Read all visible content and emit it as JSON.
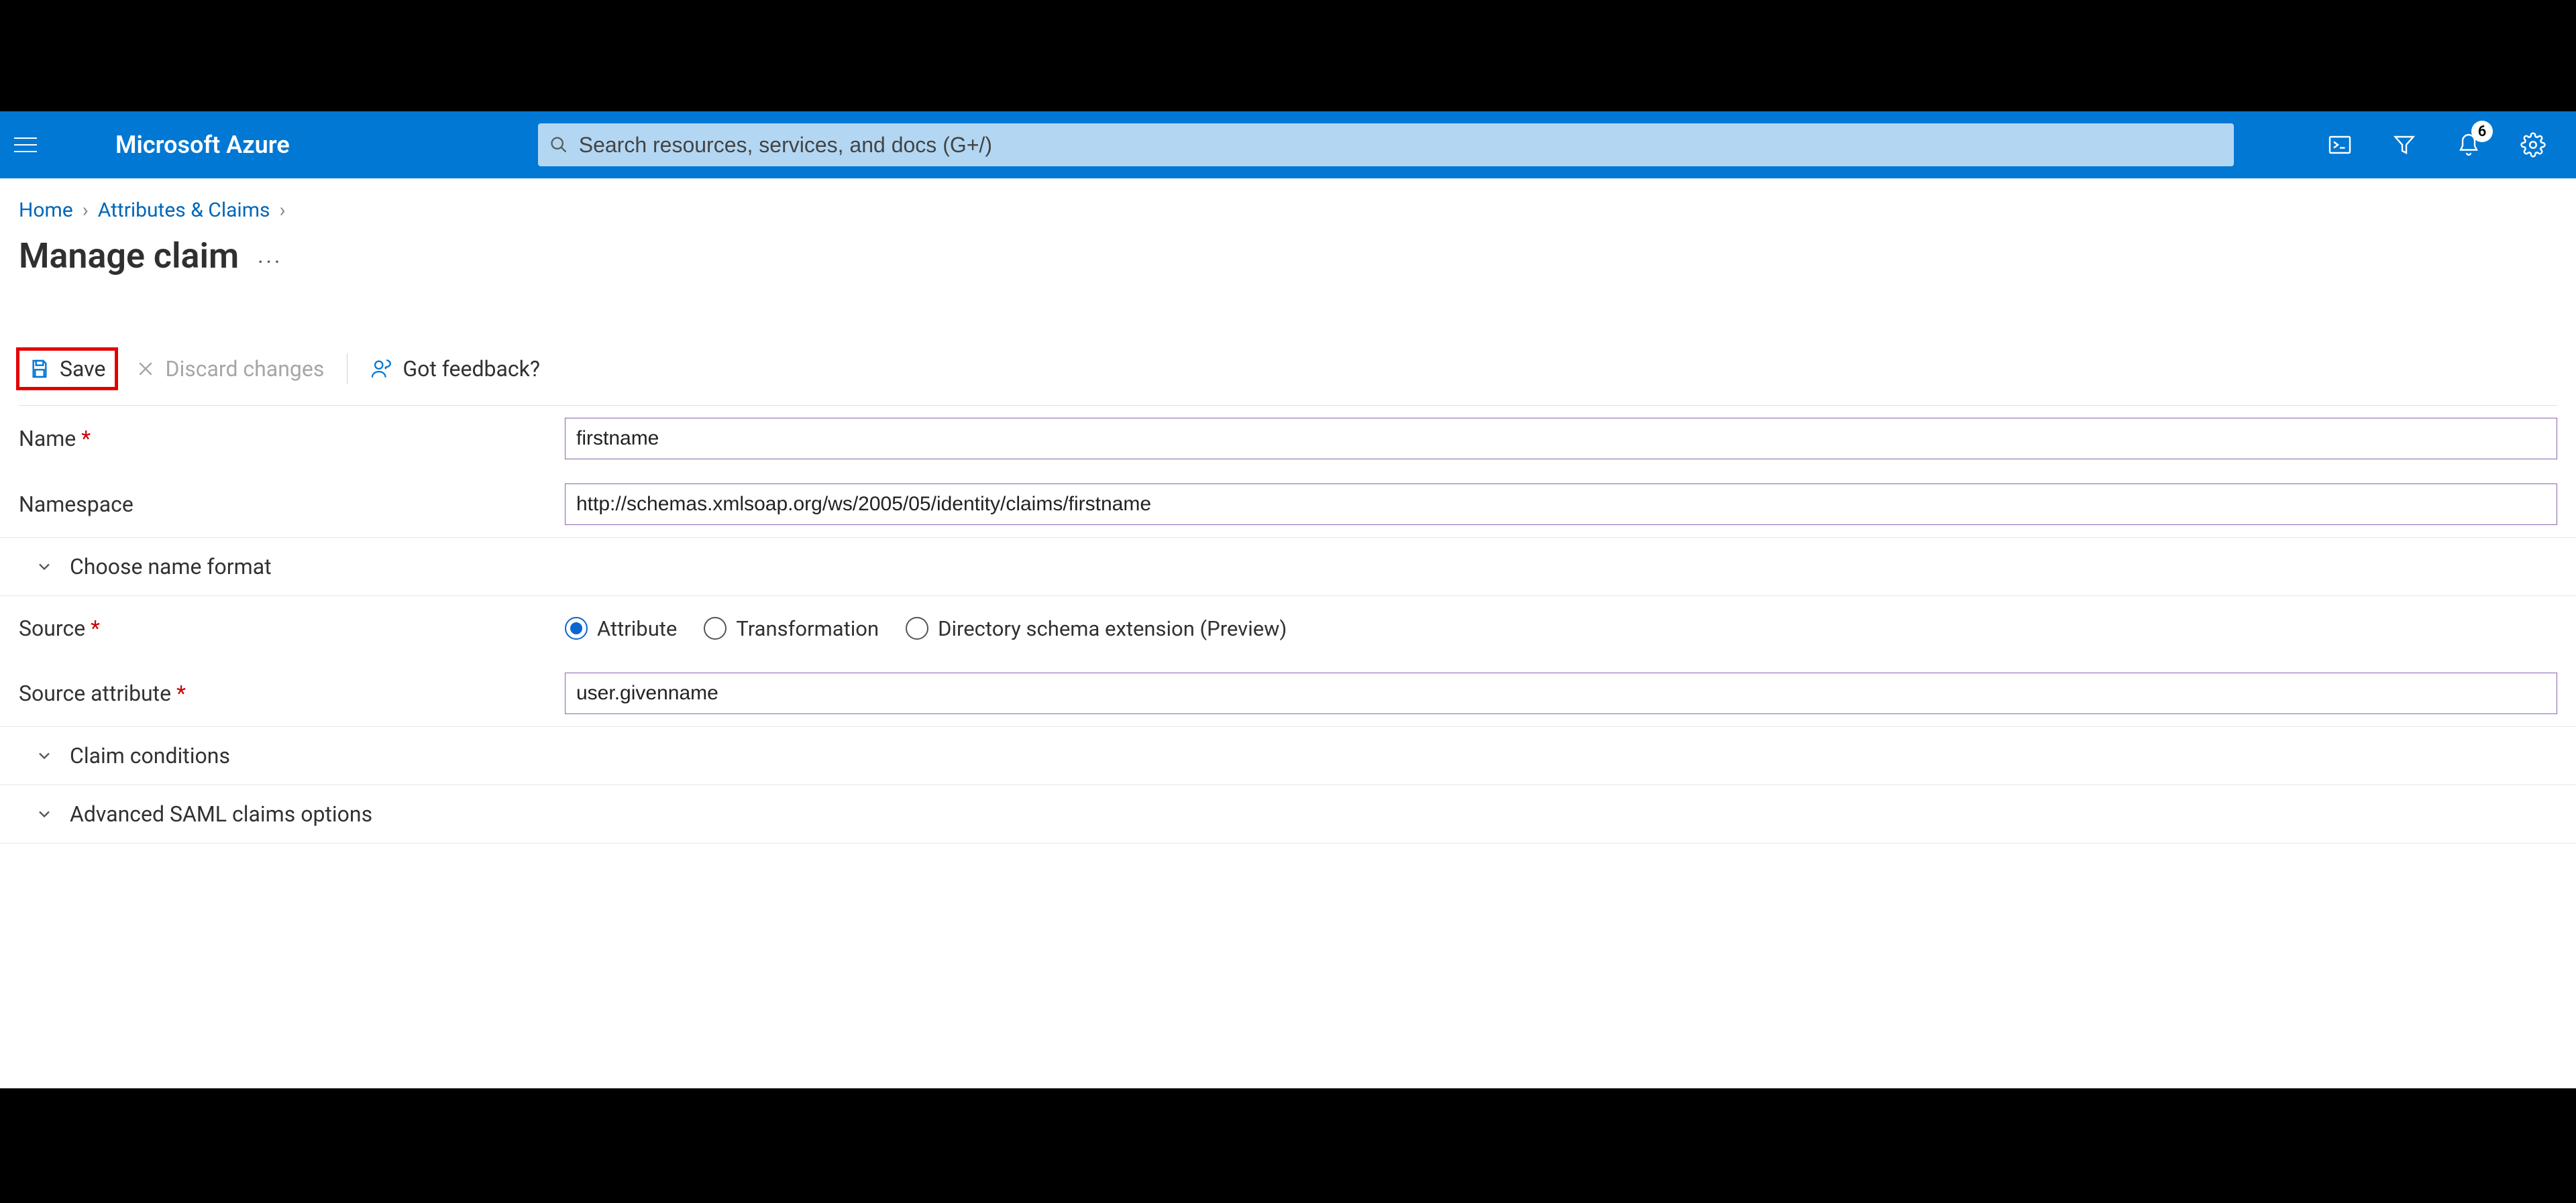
{
  "header": {
    "brand": "Microsoft Azure",
    "search_placeholder": "Search resources, services, and docs (G+/)",
    "notification_count": "6"
  },
  "breadcrumb": {
    "items": [
      "Home",
      "Attributes & Claims"
    ],
    "current": "Manage claim"
  },
  "page": {
    "title": "Manage claim"
  },
  "toolbar": {
    "save": "Save",
    "discard": "Discard changes",
    "feedback": "Got feedback?"
  },
  "form": {
    "name_label": "Name",
    "name_value": "firstname",
    "namespace_label": "Namespace",
    "namespace_value": "http://schemas.xmlsoap.org/ws/2005/05/identity/claims/firstname",
    "choose_format": "Choose name format",
    "source_label": "Source",
    "source_options": {
      "attribute": "Attribute",
      "transformation": "Transformation",
      "dir_ext": "Directory schema extension (Preview)"
    },
    "source_selected": "attribute",
    "source_attr_label": "Source attribute",
    "source_attr_value": "user.givenname",
    "claim_conditions": "Claim conditions",
    "advanced_saml": "Advanced SAML claims options"
  }
}
